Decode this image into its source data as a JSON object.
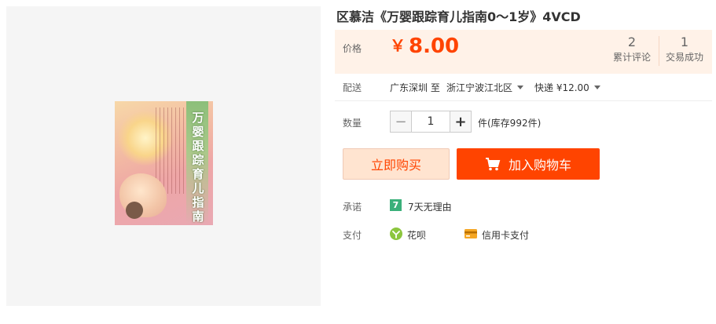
{
  "product": {
    "title": "区慕洁《万婴跟踪育儿指南0～1岁》4VCD",
    "cover_title": "万婴跟踪育儿指南"
  },
  "price": {
    "label": "价格",
    "currency": "￥",
    "amount": "8.00",
    "color": "#ff4400"
  },
  "stats": {
    "reviews_count": "2",
    "reviews_label": "累计评论",
    "deals_count": "1",
    "deals_label": "交易成功"
  },
  "shipping": {
    "label": "配送",
    "from": "广东深圳 至",
    "to": "浙江宁波江北区",
    "method": "快递 ¥12.00"
  },
  "quantity": {
    "label": "数量",
    "value": "1",
    "minus": "−",
    "plus": "+",
    "stock": "件(库存992件)"
  },
  "actions": {
    "buy_now": "立即购买",
    "add_to_cart": "加入购物车"
  },
  "promise": {
    "label": "承诺",
    "badge": "7",
    "text": "7天无理由"
  },
  "payment": {
    "label": "支付",
    "methods": [
      {
        "icon": "huabei-icon",
        "text": "花呗"
      },
      {
        "icon": "credit-card-icon",
        "text": "信用卡支付"
      }
    ]
  },
  "colors": {
    "accent": "#ff4400",
    "price_panel_bg": "#fff2e8",
    "buy_now_bg": "#ffe4d0",
    "promise_badge": "#3ab07a",
    "huabei_green": "#8cc63e",
    "card_orange": "#f5a623"
  }
}
